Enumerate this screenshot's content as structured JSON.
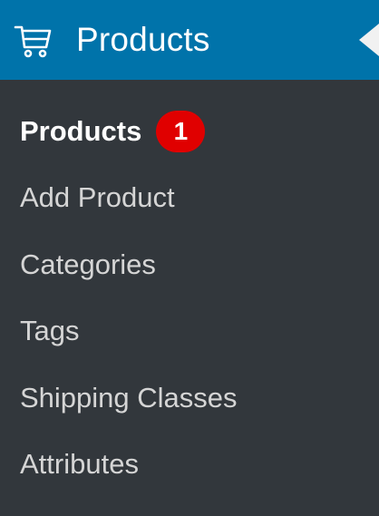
{
  "menu": {
    "header": {
      "label": "Products",
      "icon": "cart-icon"
    },
    "items": [
      {
        "label": "Products",
        "current": true,
        "badge": "1"
      },
      {
        "label": "Add Product"
      },
      {
        "label": "Categories"
      },
      {
        "label": "Tags"
      },
      {
        "label": "Shipping Classes"
      },
      {
        "label": "Attributes"
      }
    ]
  },
  "colors": {
    "menu_background": "#32373c",
    "header_background": "#0073aa",
    "badge_background": "#e00000",
    "item_text": "#d5d5d5",
    "current_text": "#ffffff"
  }
}
